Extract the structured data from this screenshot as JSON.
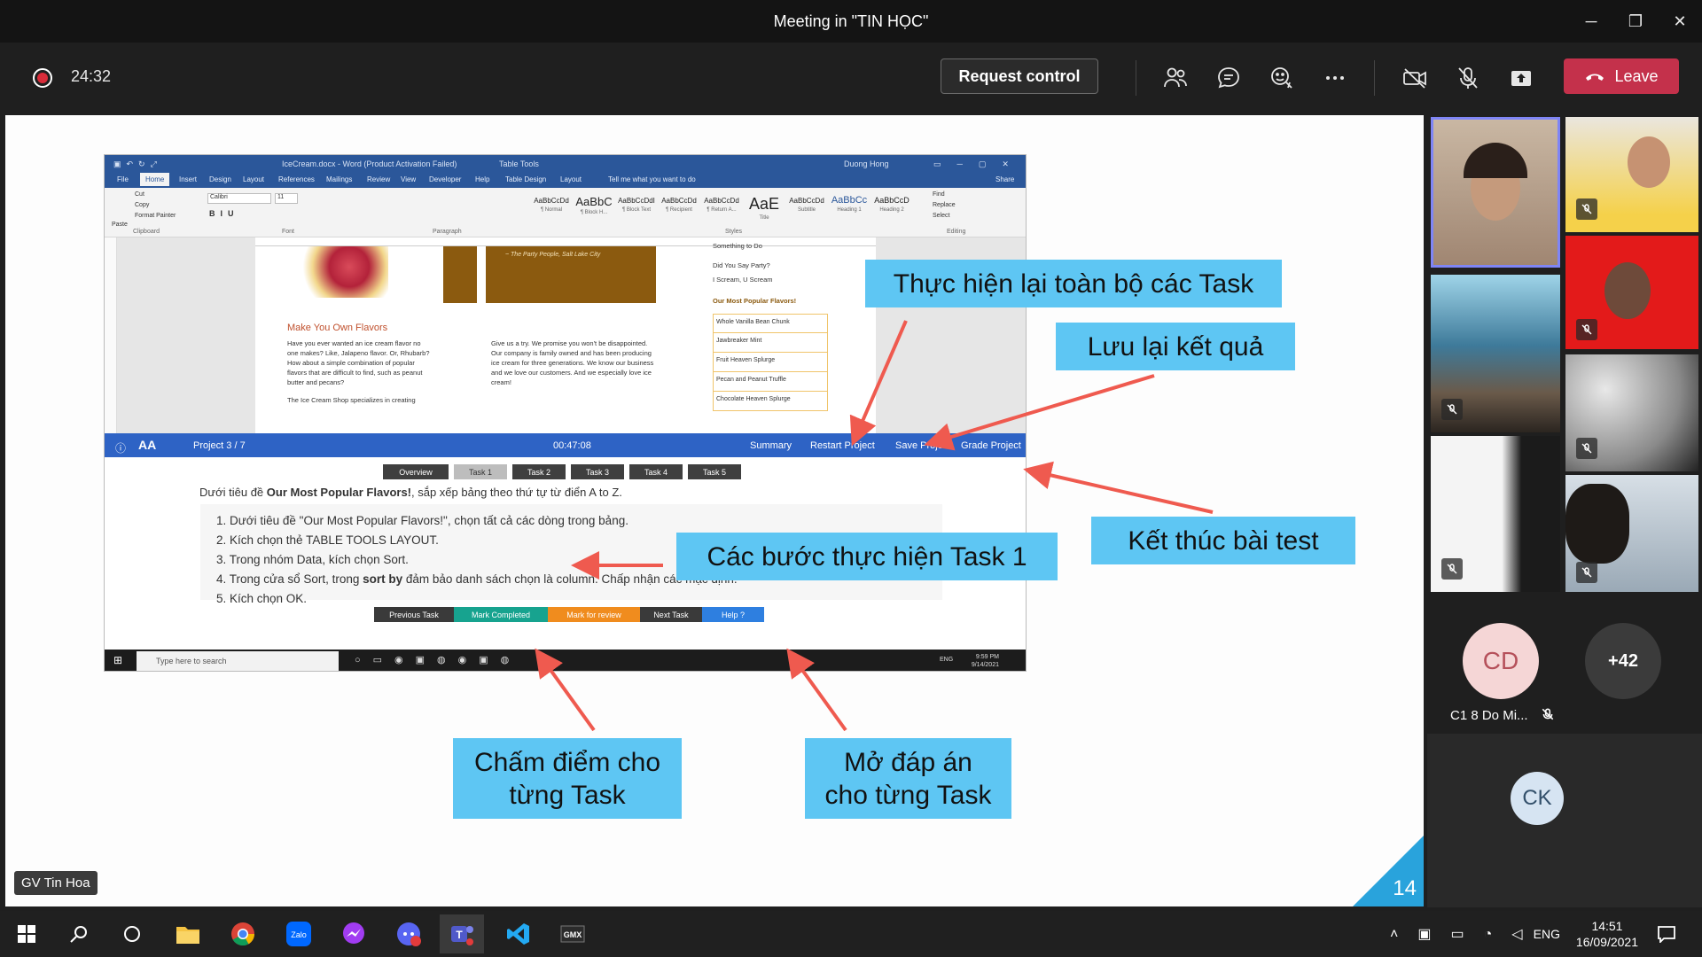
{
  "window": {
    "title": "Meeting in \"TIN HỌC\"",
    "minimize": "─",
    "restore": "❐",
    "close": "✕"
  },
  "toolbar": {
    "timer": "24:32",
    "request_control": "Request control",
    "leave": "Leave",
    "icons": [
      "participants-icon",
      "chat-icon",
      "reactions-icon",
      "more-icon",
      "camera-off-icon",
      "mic-off-icon",
      "share-icon"
    ]
  },
  "presenter": {
    "name": "GV Tin Hoa",
    "slide_number": "14"
  },
  "word": {
    "doc_title": "IceCream.docx - Word (Product Activation Failed)",
    "table_tools": "Table Tools",
    "user": "Duong Hong",
    "tabs": [
      "File",
      "Home",
      "Insert",
      "Design",
      "Layout",
      "References",
      "Mailings",
      "Review",
      "View",
      "Developer",
      "Help",
      "Table Design",
      "Layout"
    ],
    "tell_me": "Tell me what you want to do",
    "share": "Share",
    "clipboard": {
      "cut": "Cut",
      "copy": "Copy",
      "format_painter": "Format Painter",
      "paste": "Paste",
      "label": "Clipboard"
    },
    "font": {
      "name": "Calibri",
      "size": "11",
      "label": "Font"
    },
    "paragraph_label": "Paragraph",
    "styles_label": "Styles",
    "styles": [
      {
        "sample": "AaBbCcDd",
        "name": "¶ Normal"
      },
      {
        "sample": "AaBbC",
        "name": "¶ Block H..."
      },
      {
        "sample": "AaBbCcDdI",
        "name": "¶ Block Text"
      },
      {
        "sample": "AaBbCcDd",
        "name": "¶ Recipient"
      },
      {
        "sample": "AaBbCcDd",
        "name": "¶ Return A..."
      },
      {
        "sample": "AaE",
        "name": "Title"
      },
      {
        "sample": "AaBbCcDd",
        "name": "Subtitle"
      },
      {
        "sample": "AaBbCc",
        "name": "Heading 1"
      },
      {
        "sample": "AaBbCcD",
        "name": "Heading 2"
      }
    ],
    "editing": {
      "find": "Find",
      "replace": "Replace",
      "select": "Select",
      "label": "Editing"
    },
    "doc": {
      "quote": "~ The Party People, Salt Lake City",
      "heading": "Make You Own Flavors",
      "col1": "Have you ever wanted an ice cream flavor no one makes? Like, Jalapeno flavor. Or, Rhubarb? How about a simple combination of popular flavors that are difficult to find, such as peanut butter and pecans?",
      "col1b": "The Ice Cream Shop specializes in creating",
      "col2": "Give us a try. We promise you won't be disappointed. Our company is family owned and has been producing ice cream for three generations. We know our business and we love our customers. And we especially love ice cream!",
      "col3_top": "Something to Do",
      "col3_a": "Did You Say Party?",
      "col3_b": "I Scream, U Scream",
      "list_title": "Our Most Popular Flavors!",
      "flavors": [
        "Whole Vanilla Bean Chunk",
        "Jawbreaker Mint",
        "Fruit Heaven Splurge",
        "Pecan and Peanut Truffle",
        "Chocolate Heaven Splurge"
      ]
    },
    "taskbar": {
      "search": "Type here to search",
      "lang": "ENG",
      "time": "9:59 PM",
      "date": "9/14/2021"
    }
  },
  "exam": {
    "project": "Project 3 / 7",
    "timer": "00:47:08",
    "actions": [
      "Summary",
      "Restart Project",
      "Save Project",
      "Grade Project"
    ],
    "tabs": [
      "Overview",
      "Task 1",
      "Task 2",
      "Task 3",
      "Task 4",
      "Task 5"
    ],
    "instruction_pre": "Dưới tiêu đề ",
    "instruction_bold": "Our Most Popular Flavors!",
    "instruction_post": ", sắp xếp bảng theo thứ tự từ điển A to Z.",
    "steps": [
      "1. Dưới tiêu đề \"Our Most Popular Flavors!\", chọn tất cả các dòng trong bảng.",
      "2. Kích chọn thẻ TABLE TOOLS LAYOUT.",
      "3. Trong nhóm Data, kích chọn Sort.",
      "5. Kích chọn OK."
    ],
    "step4_pre": "4. Trong cửa sổ Sort, trong ",
    "step4_bold": "sort by",
    "step4_post": " đảm bảo danh sách chọn là column. Chấp nhận các mặc định.",
    "buttons": [
      "Previous Task",
      "Mark Completed",
      "Mark for review",
      "Next Task",
      "Help ?"
    ],
    "button_colors": [
      "#3a3a3a",
      "#17a38f",
      "#f08c1e",
      "#3a3a3a",
      "#2e7fe0"
    ]
  },
  "callouts": {
    "redo_all": "Thực hiện lại toàn bộ các Task",
    "save": "Lưu lại kết quả",
    "finish": "Kết thúc bài test",
    "steps": "Các bước thực hiện Task 1",
    "grade_line1": "Chấm điểm cho",
    "grade_line2": "từng Task",
    "answer_line1": "Mở đáp án",
    "answer_line2": "cho từng Task"
  },
  "participants": {
    "cd_initials": "CD",
    "cd_name": "C1 8 Do Mi...",
    "more": "+42",
    "ck_initials": "CK"
  },
  "taskbar": {
    "lang": "ENG",
    "time": "14:51",
    "date": "16/09/2021"
  },
  "colors": {
    "accent_blue": "#5ec6f3",
    "leave_red": "#c4314b",
    "arrow_red": "#ef5a4f",
    "word_blue": "#2b579a"
  }
}
